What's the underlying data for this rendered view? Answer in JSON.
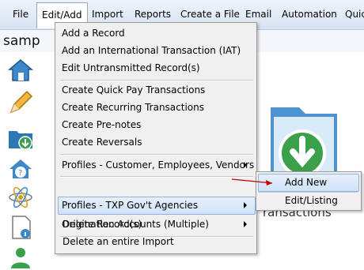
{
  "menubar": {
    "items": [
      "File",
      "Edit/Add",
      "Import",
      "Reports",
      "Create a File",
      "Email",
      "Automation",
      "Quic"
    ]
  },
  "document": {
    "title_fragment": "samp"
  },
  "background": {
    "caption": "ransactions"
  },
  "menu": {
    "items": [
      "Add a Record",
      "Add an International Transaction (IAT)",
      "Edit Untransmitted Record(s)",
      "Create Quick Pay Transactions",
      "Create Recurring Transactions",
      "Create Pre-notes",
      "Create Reversals",
      "Profiles - Customer, Employees, Vendors",
      "Profiles - TXP Gov't Agencies",
      "Origination Accounts (Multiple)",
      "Delete Record(s)",
      "Delete an entire Import"
    ],
    "highlighted": "Profiles - TXP Gov't Agencies"
  },
  "submenu": {
    "items": [
      "Add New",
      "Edit/Listing"
    ],
    "highlighted": "Add New"
  },
  "colors": {
    "menubar": "#dce7f5",
    "highlight": "#cfe2f7",
    "annotation_arrow": "#c00000"
  }
}
